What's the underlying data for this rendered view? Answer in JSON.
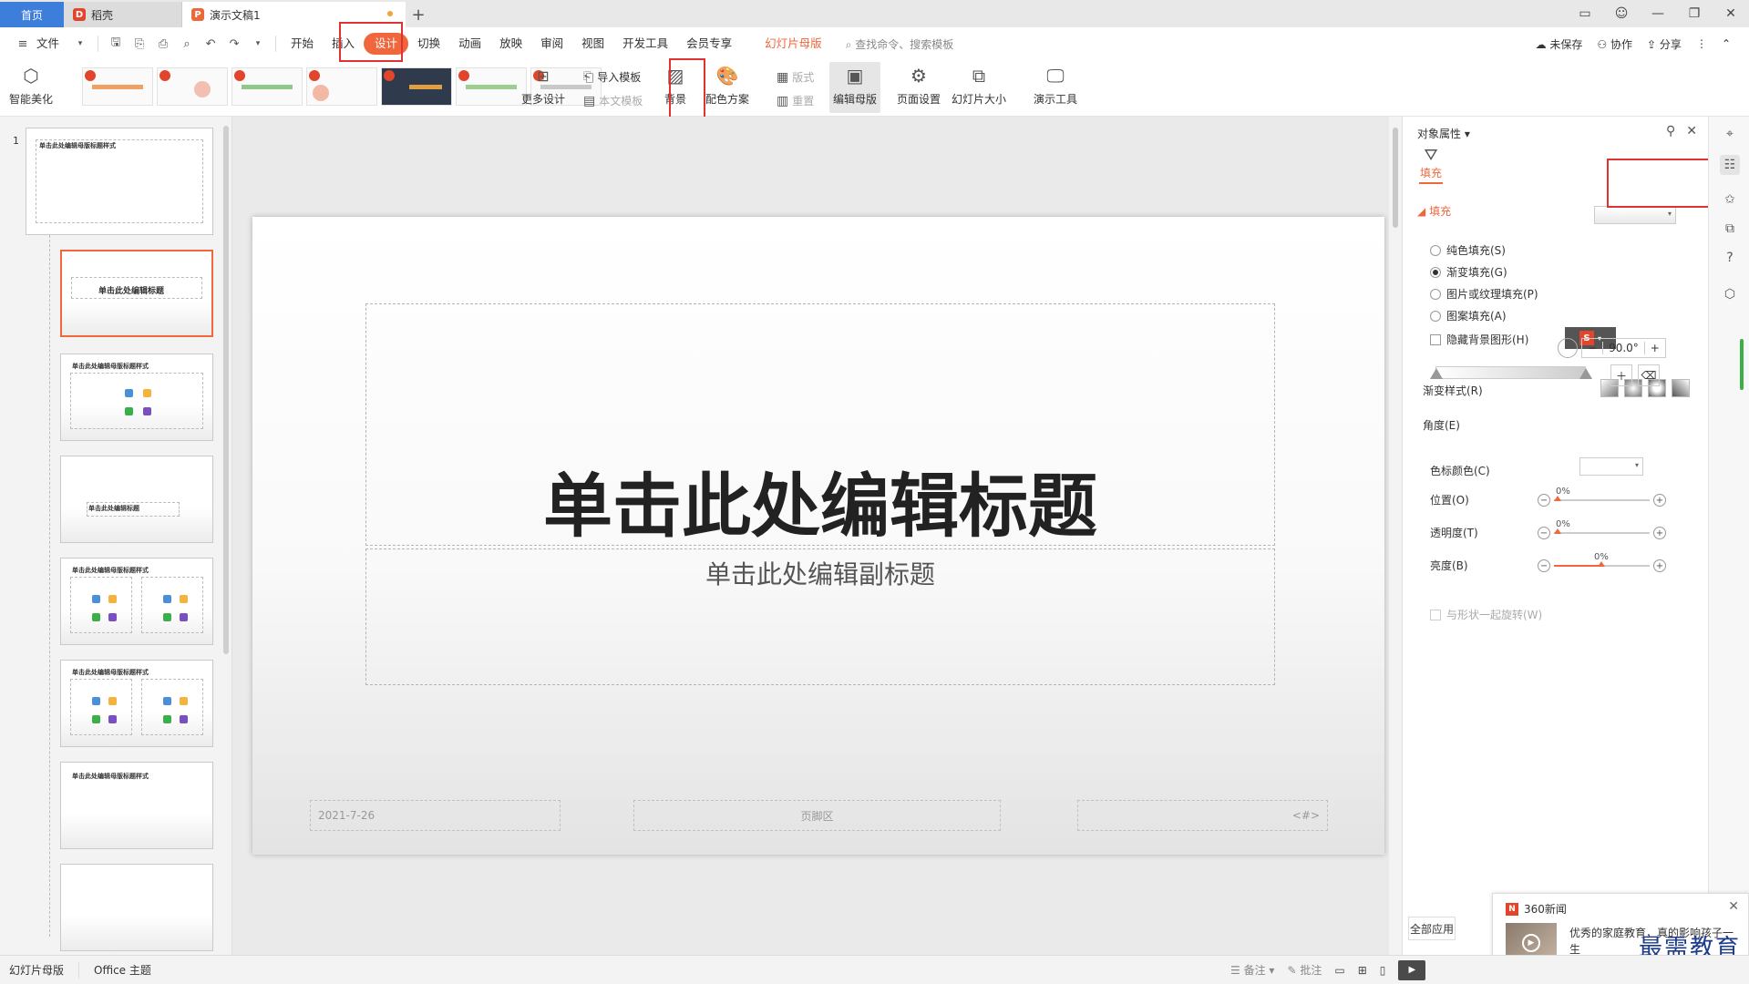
{
  "titlebar": {
    "home_tab": "首页",
    "doc_tab": "稻壳",
    "active_tab": "演示文稿1",
    "new_tab": "+"
  },
  "menu": {
    "file": "文件",
    "items": [
      "开始",
      "插入",
      "设计",
      "切换",
      "动画",
      "放映",
      "审阅",
      "视图",
      "开发工具",
      "会员专享",
      "幻灯片母版"
    ],
    "active": "设计",
    "search_hint": "查找命令、搜索模板",
    "right": {
      "unsaved": "未保存",
      "collab": "协作",
      "share": "分享"
    }
  },
  "ribbon": {
    "beautify": "智能美化",
    "more_design": "更多设计",
    "import_template": "导入模板",
    "this_template": "本文模板",
    "background": "背景",
    "color_scheme": "配色方案",
    "layout": "版式",
    "reset": "重置",
    "edit_master": "编辑母版",
    "page_setup": "页面设置",
    "slide_size": "幻灯片大小",
    "presentation_tools": "演示工具"
  },
  "thumbnails": {
    "slide1_title": "单击此处编辑母版标题样式",
    "slide2_title": "单击此处编辑标题",
    "slide3_title": "单击此处编辑母版标题样式",
    "slide4_title": "单击此处编辑标题",
    "slide5_title": "单击此处编辑母版标题样式",
    "slide6_title": "单击此处编辑母版标题样式",
    "slide7_title": "单击此处编辑母版标题样式",
    "slide_number": "1"
  },
  "slide": {
    "title": "单击此处编辑标题",
    "subtitle": "单击此处编辑副标题",
    "date": "2021-7-26",
    "footer": "页脚区",
    "number": "<#>"
  },
  "pane": {
    "header": "对象属性",
    "tab": "填充",
    "section": "填充",
    "options": [
      "纯色填充(S)",
      "渐变填充(G)",
      "图片或纹理填充(P)",
      "图案填充(A)"
    ],
    "selected_option": 1,
    "hide_bg": "隐藏背景图形(H)",
    "gradient_style": "渐变样式(R)",
    "angle": "角度(E)",
    "angle_value": "90.0°",
    "color": "色标颜色(C)",
    "position": "位置(O)",
    "position_value": "0%",
    "transparency": "透明度(T)",
    "transparency_value": "0%",
    "brightness": "亮度(B)",
    "brightness_value": "0%",
    "rotate_with_shape": "与形状一起旋转(W)",
    "apply_all": "全部应用"
  },
  "notification": {
    "source": "360新闻",
    "message": "优秀的家庭教育，真的影响孩子一生",
    "watermark": "最需教育"
  },
  "statusbar": {
    "mode": "幻灯片母版",
    "theme": "Office 主题",
    "notes": "备注",
    "comments": "批注"
  },
  "colors": {
    "accent": "#f0673d",
    "highlight": "#e03232",
    "home_tab": "#3d7edb"
  }
}
